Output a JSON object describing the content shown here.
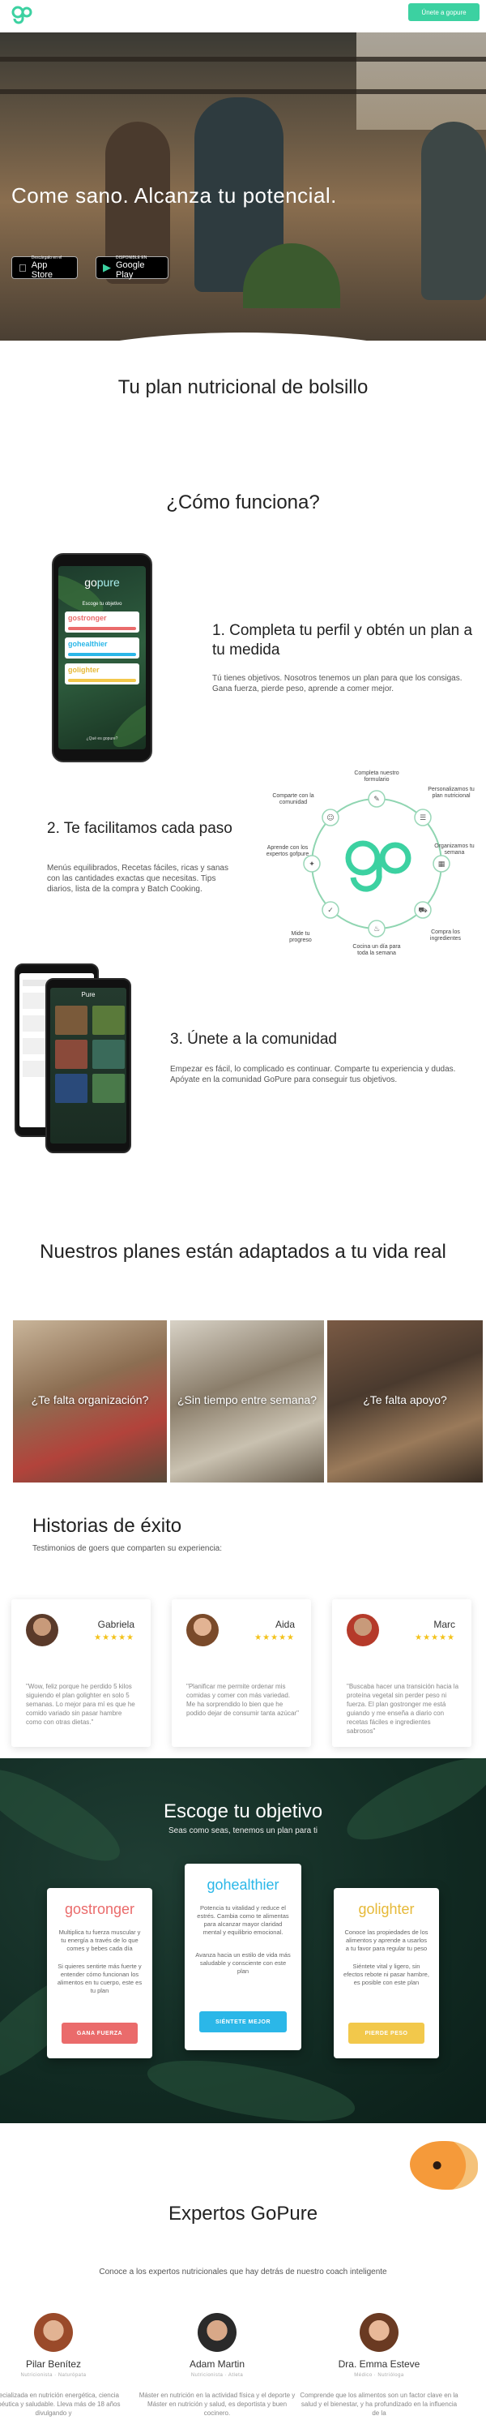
{
  "header": {
    "logo_alt": "go",
    "join_label": "Únete a gopure"
  },
  "hero": {
    "title": "Come sano. Alcanza tu potencial.",
    "app_store_small": "Descárgalo en el",
    "app_store_big": "App Store",
    "google_play_small": "DISPONIBLE EN",
    "google_play_big": "Google Play"
  },
  "intro": {
    "tagline": "Tu plan nutricional de bolsillo",
    "how_title": "¿Cómo funciona?"
  },
  "steps": [
    {
      "title": "1. Completa tu perfil y obtén un plan a tu medida",
      "desc": "Tú tienes objetivos. Nosotros tenemos un plan para que los consigas. Gana fuerza, pierde peso, aprende a comer mejor."
    },
    {
      "title": "2. Te facilitamos cada paso",
      "desc": "Menús equilibrados, Recetas fáciles, ricas y sanas con las cantidades exactas que necesitas. Tips diarios, lista de la compra y Batch Cooking."
    },
    {
      "title": "3. Únete a la comunidad",
      "desc": "Empezar es fácil, lo complicado es continuar. Comparte tu experiencia y dudas. Apóyate en la comunidad GoPure para conseguir tus objetivos."
    }
  ],
  "phone1": {
    "header": "Escoge tu objetivo",
    "plans": [
      "gostronger",
      "gohealthier",
      "golighter"
    ],
    "footer": "¿Qué es gopure?"
  },
  "cycle": {
    "labels": [
      "Completa nuestro formulario",
      "Personalizamos tu plan nutricional",
      "Organizamos tu semana",
      "Compra los ingredientes",
      "Cocina un día para toda la semana",
      "Mide tu progreso",
      "Aprende con los expertos gofpure",
      "Comparte con la comunidad"
    ]
  },
  "community_phone": {
    "header": "Pure"
  },
  "plans_section": {
    "title": "Nuestros planes están adaptados a tu vida real",
    "tiles": [
      "¿Te falta organización?",
      "¿Sin tiempo entre semana?",
      "¿Te falta apoyo?"
    ]
  },
  "stories": {
    "title": "Historias de éxito",
    "subtitle": "Testimonios de goers que comparten su experiencia:",
    "items": [
      {
        "name": "Gabriela",
        "stars": "★★★★★",
        "quote": "\"Wow, feliz porque he perdido 5 kilos siguiendo el plan golighter en solo 5 semanas. Lo mejor para mí es que he comido variado sin pasar hambre como con otras dietas.\""
      },
      {
        "name": "Aida",
        "stars": "★★★★★",
        "quote": "\"Planificar me permite ordenar mis comidas y comer con más variedad. Me ha sorprendido lo bien que he podido dejar de consumir tanta azúcar\""
      },
      {
        "name": "Marc",
        "stars": "★★★★★",
        "quote": "\"Buscaba hacer una transición hacia la proteína vegetal sin perder peso ni fuerza. El plan gostronger me está guiando y me enseña a diario con recetas fáciles e ingredientes sabrosos\""
      }
    ]
  },
  "goals": {
    "title": "Escoge tu objetivo",
    "subtitle": "Seas como seas, tenemos un plan para ti",
    "cards": [
      {
        "name": "gostronger",
        "desc1": "Multiplica tu fuerza muscular y tu energía a través de lo que comes y bebes cada día",
        "desc2": "Si quieres sentirte más fuerte y entender cómo funcionan los alimentos en tu cuerpo, este es tu plan",
        "button": "GANA FUERZA",
        "color": "#ea6b6b"
      },
      {
        "name": "gohealthier",
        "desc1": "Potencia tu vitalidad y reduce el estrés. Cambia como te alimentas para alcanzar mayor claridad mental y equilibrio emocional.",
        "desc2": "Avanza hacia un estilo de vida más saludable y consciente con este plan",
        "button": "SIÉNTETE MEJOR",
        "color": "#2bb7e8"
      },
      {
        "name": "golighter",
        "desc1": "Conoce las propiedades de los alimentos y aprende a usarlos a tu favor para regular tu peso",
        "desc2": "Siéntete vital y ligero, sin efectos rebote ni pasar hambre, es posible con este plan",
        "button": "PIERDE PESO",
        "color": "#f2c84b"
      }
    ]
  },
  "experts": {
    "title": "Expertos GoPure",
    "subtitle": "Conoce a los expertos nutricionales que hay detrás de nuestro coach inteligente",
    "items": [
      {
        "name": "Pilar Benítez",
        "role": "Nutricionista · Naturópata",
        "bio": "Especializada en nutrición energética, ciencia terapéutica y saludable. Lleva más de 18 años divulgando y"
      },
      {
        "name": "Adam Martin",
        "role": "Nutricionista · Atleta",
        "bio": "Máster en nutrición en la actividad física y el deporte y Máster en nutrición y salud, es deportista y buen cocinero."
      },
      {
        "name": "Dra. Emma Esteve",
        "role": "Médico · Nutrióloga",
        "bio": "Comprende que los alimentos son un factor clave en la salud y el bienestar, y ha profundizado en la influencia de la"
      }
    ]
  }
}
